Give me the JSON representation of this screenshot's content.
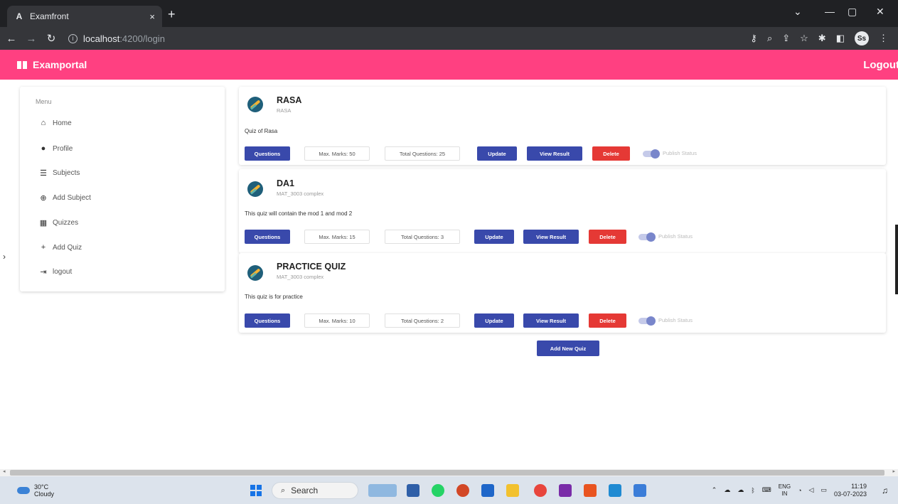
{
  "browser": {
    "tab_title": "Examfront",
    "tab_favicon": "A",
    "tab_close": "×",
    "new_tab": "+",
    "url_host": "localhost",
    "url_path": ":4200/login",
    "profile_initials": "Ss"
  },
  "appbar": {
    "brand": "Examportal",
    "logout": "Logout"
  },
  "sidebar": {
    "title": "Menu",
    "items": [
      {
        "label": "Home"
      },
      {
        "label": "Profile"
      },
      {
        "label": "Subjects"
      },
      {
        "label": "Add Subject"
      },
      {
        "label": "Quizzes"
      },
      {
        "label": "Add Quiz"
      },
      {
        "label": "logout"
      }
    ]
  },
  "quizzes": [
    {
      "title": "RASA",
      "subtitle": "RASA",
      "description": "Quiz of Rasa",
      "questions_label": "Questions",
      "max_marks": "Max. Marks: 50",
      "total_questions": "Total Questions: 25",
      "update_label": "Update",
      "view_result_label": "View Result",
      "delete_label": "Delete",
      "publish_label": "Publish Status"
    },
    {
      "title": "DA1",
      "subtitle": "MAT_3003 complex",
      "description": "This quiz will contain the mod 1 and mod 2",
      "questions_label": "Questions",
      "max_marks": "Max. Marks: 15",
      "total_questions": "Total Questions: 3",
      "update_label": "Update",
      "view_result_label": "View Result",
      "delete_label": "Delete",
      "publish_label": "Publish Status"
    },
    {
      "title": "PRACTICE QUIZ",
      "subtitle": "MAT_3003 complex",
      "description": "This quiz is for practice",
      "questions_label": "Questions",
      "max_marks": "Max. Marks: 10",
      "total_questions": "Total Questions: 2",
      "update_label": "Update",
      "view_result_label": "View Result",
      "delete_label": "Delete",
      "publish_label": "Publish Status"
    }
  ],
  "add_quiz_button": "Add New Quiz",
  "taskbar": {
    "temperature": "30°C",
    "weather": "Cloudy",
    "search_label": "Search",
    "lang_top": "ENG",
    "lang_bottom": "IN",
    "time": "11:19",
    "date": "03-07-2023"
  },
  "colors": {
    "appbar": "#ff4081",
    "primary": "#3949ab",
    "warn": "#e53935"
  }
}
